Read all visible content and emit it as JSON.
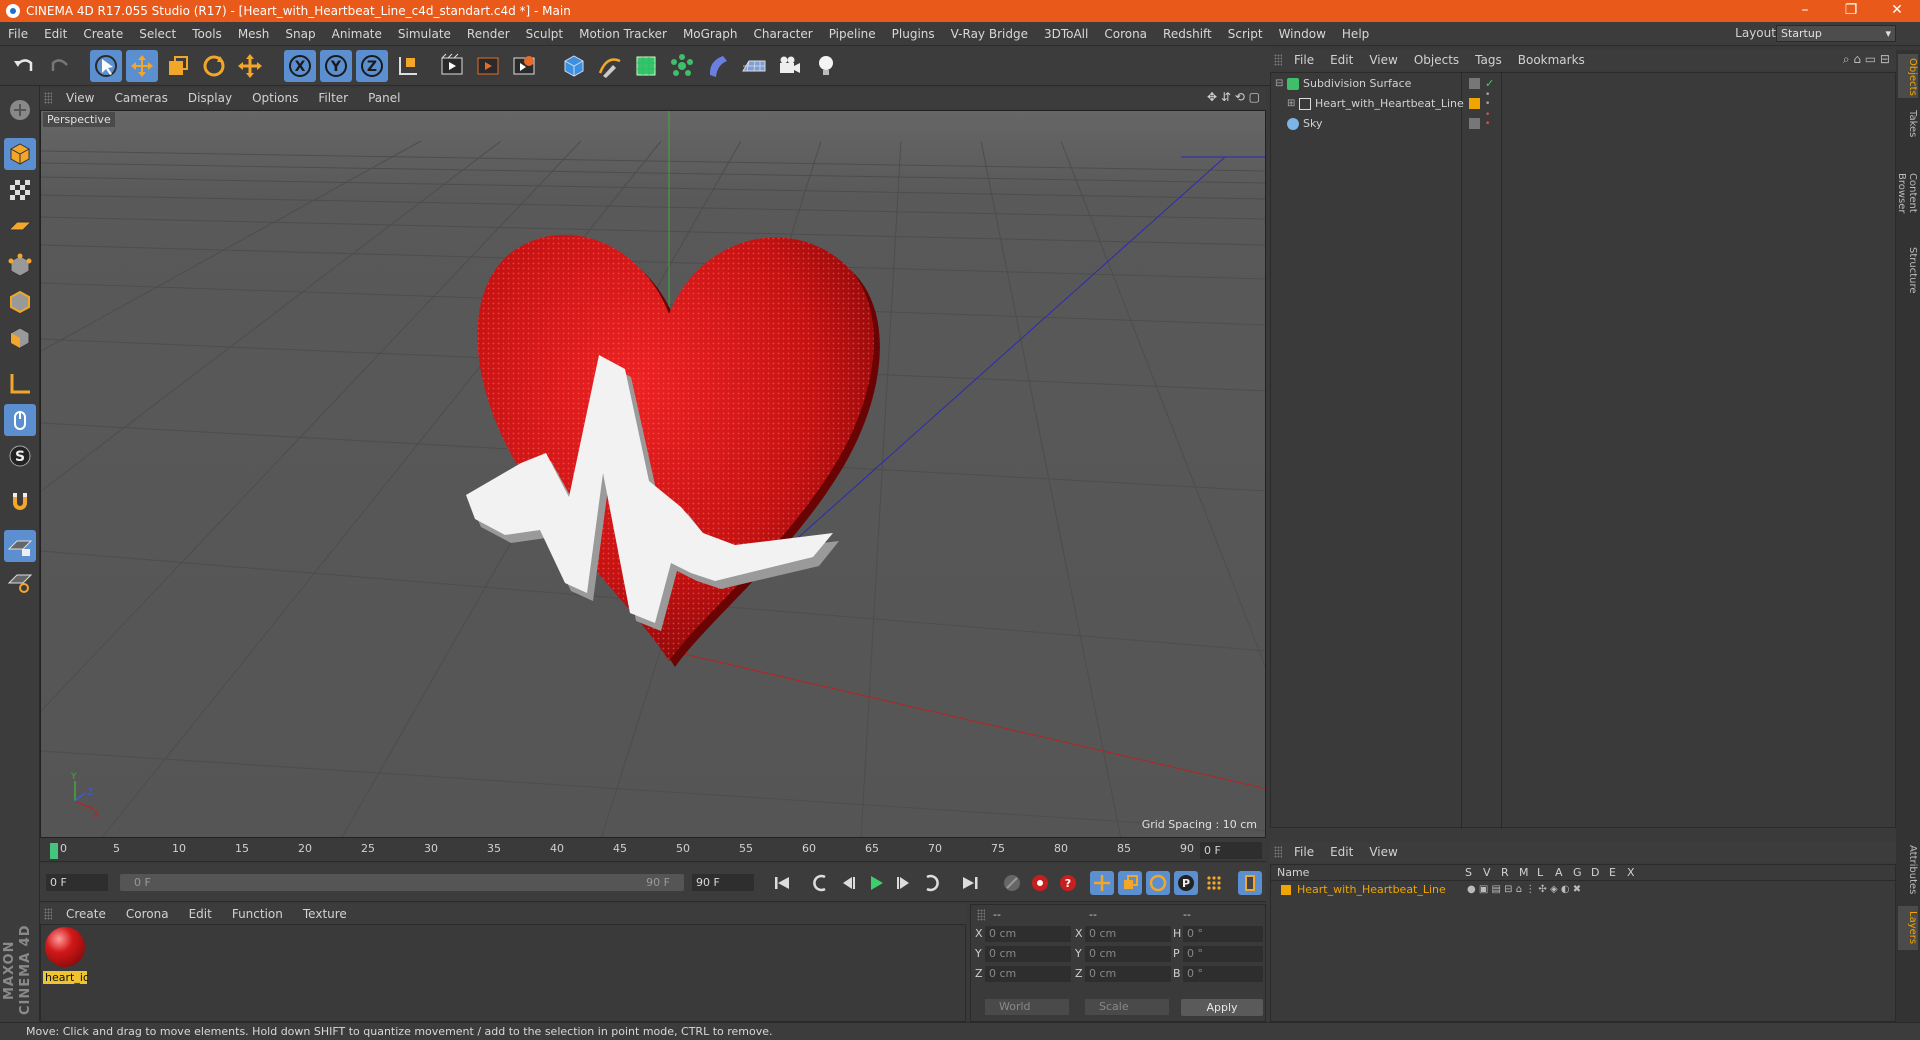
{
  "window": {
    "title": "CINEMA 4D R17.055 Studio (R17) - [Heart_with_Heartbeat_Line_c4d_standart.c4d *] - Main",
    "controls": [
      "–",
      "❐",
      "✕"
    ]
  },
  "menubar": {
    "items": [
      "File",
      "Edit",
      "Create",
      "Select",
      "Tools",
      "Mesh",
      "Snap",
      "Animate",
      "Simulate",
      "Render",
      "Sculpt",
      "Motion Tracker",
      "MoGraph",
      "Character",
      "Pipeline",
      "Plugins",
      "V-Ray Bridge",
      "3DToAll",
      "Corona",
      "Redshift",
      "Script",
      "Window",
      "Help"
    ],
    "layout_label": "Layout:",
    "layout_value": "Startup"
  },
  "toolbar": {
    "axis_x": "X",
    "axis_y": "Y",
    "axis_z": "Z"
  },
  "viewport": {
    "menu": [
      "View",
      "Cameras",
      "Display",
      "Options",
      "Filter",
      "Panel"
    ],
    "camera_label": "Perspective",
    "grid_spacing": "Grid Spacing : 10 cm"
  },
  "timeline": {
    "ticks": [
      "0",
      "5",
      "10",
      "15",
      "20",
      "25",
      "30",
      "35",
      "40",
      "45",
      "50",
      "55",
      "60",
      "65",
      "70",
      "75",
      "80",
      "85",
      "90"
    ],
    "end_field": "0 F"
  },
  "transport": {
    "start_field": "0 F",
    "range_start": "0 F",
    "range_end": "90 F",
    "end_field": "90 F"
  },
  "material_manager": {
    "menu": [
      "Create",
      "Corona",
      "Edit",
      "Function",
      "Texture"
    ],
    "materials": [
      {
        "name": "heart_ic"
      }
    ]
  },
  "coordinates": {
    "header_a": "--",
    "header_b": "--",
    "header_c": "--",
    "rows": [
      {
        "l1": "X",
        "v1": "0 cm",
        "l2": "X",
        "v2": "0 cm",
        "l3": "H",
        "v3": "0 °"
      },
      {
        "l1": "Y",
        "v1": "0 cm",
        "l2": "Y",
        "v2": "0 cm",
        "l3": "P",
        "v3": "0 °"
      },
      {
        "l1": "Z",
        "v1": "0 cm",
        "l2": "Z",
        "v2": "0 cm",
        "l3": "B",
        "v3": "0 °"
      }
    ],
    "space_select": "World",
    "scale_select": "Scale",
    "apply_label": "Apply"
  },
  "object_manager": {
    "menu": [
      "File",
      "Edit",
      "View",
      "Objects",
      "Tags",
      "Bookmarks"
    ],
    "objects": [
      {
        "name": "Subdivision Surface",
        "icon": "subdivision-icon"
      },
      {
        "name": "Heart_with_Heartbeat_Line",
        "icon": "null-object-icon"
      },
      {
        "name": "Sky",
        "icon": "sky-icon"
      }
    ]
  },
  "layer_manager": {
    "menu": [
      "File",
      "Edit",
      "View"
    ],
    "columns": [
      "Name",
      "S",
      "V",
      "R",
      "M",
      "L",
      "A",
      "G",
      "D",
      "E",
      "X"
    ],
    "layers": [
      {
        "name": "Heart_with_Heartbeat_Line",
        "color": "#f0a500"
      }
    ]
  },
  "side_tabs": [
    "Objects",
    "Takes",
    "Content Browser",
    "Structure",
    "Attributes",
    "Layers"
  ],
  "status": {
    "text": "Move: Click and drag to move elements. Hold down SHIFT to quantize movement / add to the selection in point mode, CTRL to remove."
  },
  "logo": {
    "text": "MAXON CINEMA 4D"
  },
  "colors": {
    "accent_orange": "#e8591a",
    "selection_blue": "#5b8fd0",
    "layer_orange": "#f0a500",
    "heart_red": "#c8141e"
  }
}
